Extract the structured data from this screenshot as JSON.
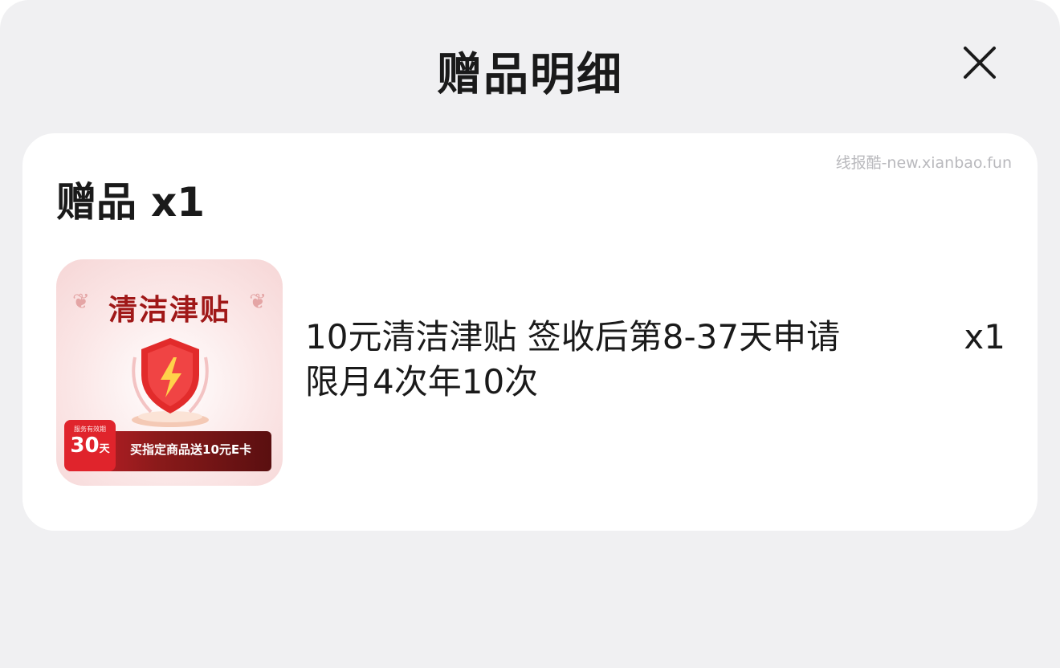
{
  "header": {
    "title": "赠品明细",
    "close_icon": "close-icon"
  },
  "card": {
    "watermark": "线报酷-new.xianbao.fun",
    "section_title": "赠品",
    "section_count": "x1",
    "item": {
      "thumbnail": {
        "title": "清洁津贴",
        "badge_small": "服务有效期",
        "badge_big": "30",
        "badge_unit": "天",
        "ribbon_text": "买指定商品送10元E卡",
        "icon": "shield-lightning-icon"
      },
      "name_line1": "10元清洁津贴 签收后第8-37天申请",
      "name_line2": "限月4次年10次",
      "quantity": "x1"
    }
  },
  "colors": {
    "sheet_background": "#f0f0f2",
    "card_background": "#ffffff",
    "text_primary": "#1a1a1a",
    "brand_red": "#e0242c"
  }
}
